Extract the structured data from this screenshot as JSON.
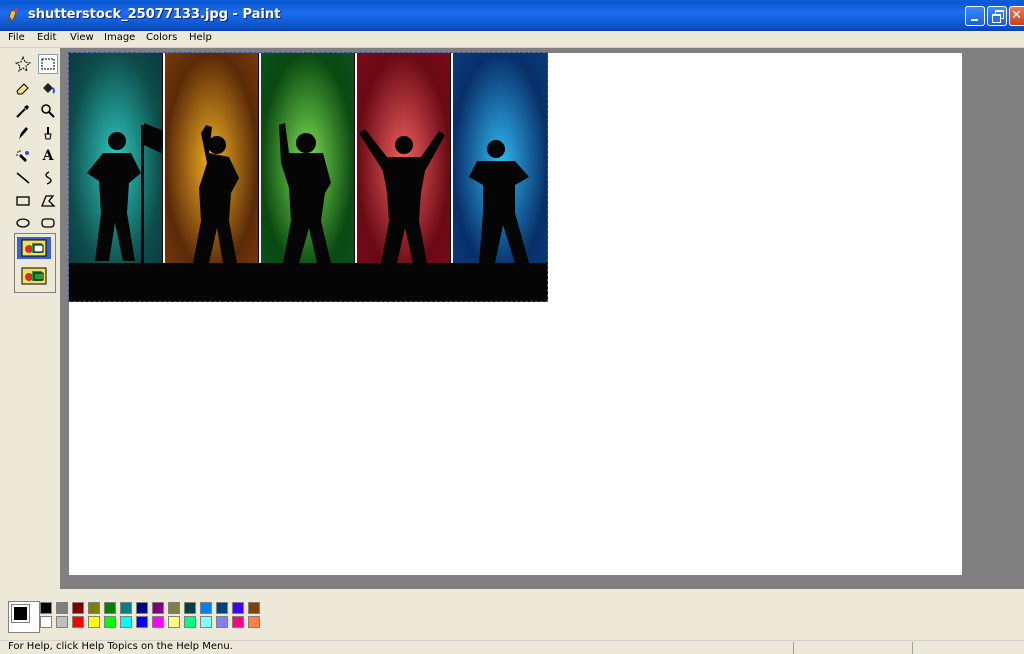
{
  "window": {
    "title": "shutterstock_25077133.jpg - Paint",
    "app_icon": "paint-icon",
    "controls": [
      "minimize-icon",
      "restore-icon",
      "close-icon"
    ]
  },
  "menu": [
    "File",
    "Edit",
    "View",
    "Image",
    "Colors",
    "Help"
  ],
  "tools": [
    {
      "name": "free-form-select",
      "icon": "free-select-icon"
    },
    {
      "name": "select",
      "icon": "rect-select-icon",
      "selected": true
    },
    {
      "name": "eraser",
      "icon": "eraser-icon"
    },
    {
      "name": "fill",
      "icon": "fill-icon"
    },
    {
      "name": "pick-color",
      "icon": "eyedropper-icon"
    },
    {
      "name": "magnifier",
      "icon": "magnifier-icon"
    },
    {
      "name": "pencil",
      "icon": "pencil-icon"
    },
    {
      "name": "brush",
      "icon": "brush-icon"
    },
    {
      "name": "airbrush",
      "icon": "airbrush-icon"
    },
    {
      "name": "text",
      "icon": "text-icon",
      "glyph": "A"
    },
    {
      "name": "line",
      "icon": "line-icon"
    },
    {
      "name": "curve",
      "icon": "curve-icon"
    },
    {
      "name": "rectangle",
      "icon": "rectangle-icon"
    },
    {
      "name": "polygon",
      "icon": "polygon-icon"
    },
    {
      "name": "ellipse",
      "icon": "ellipse-icon"
    },
    {
      "name": "rounded-rectangle",
      "icon": "rounded-rect-icon"
    }
  ],
  "image_panels": [
    {
      "colors": [
        "#0d4d4a",
        "#2fc9c0",
        "#0a3a40"
      ]
    },
    {
      "colors": [
        "#5a2a08",
        "#f2b020",
        "#7a3a08"
      ]
    },
    {
      "colors": [
        "#0a4a12",
        "#7ee050",
        "#0a5020"
      ]
    },
    {
      "colors": [
        "#6a0a14",
        "#f06060",
        "#7a0a18"
      ]
    },
    {
      "colors": [
        "#08306a",
        "#30b8f0",
        "#0a3a7a"
      ]
    }
  ],
  "colors": {
    "foreground": "#000000",
    "background": "#ffffff",
    "palette_top": [
      "#000000",
      "#808080",
      "#800000",
      "#808000",
      "#008000",
      "#008080",
      "#000080",
      "#800080",
      "#808040",
      "#004040",
      "#0080ff",
      "#004080",
      "#4000ff",
      "#804000"
    ],
    "palette_bottom": [
      "#ffffff",
      "#c0c0c0",
      "#ff0000",
      "#ffff00",
      "#00ff00",
      "#00ffff",
      "#0000ff",
      "#ff00ff",
      "#ffff80",
      "#00ff80",
      "#80ffff",
      "#8080ff",
      "#ff0080",
      "#ff8040"
    ]
  },
  "status": {
    "help_text": "For Help, click Help Topics on the Help Menu."
  }
}
